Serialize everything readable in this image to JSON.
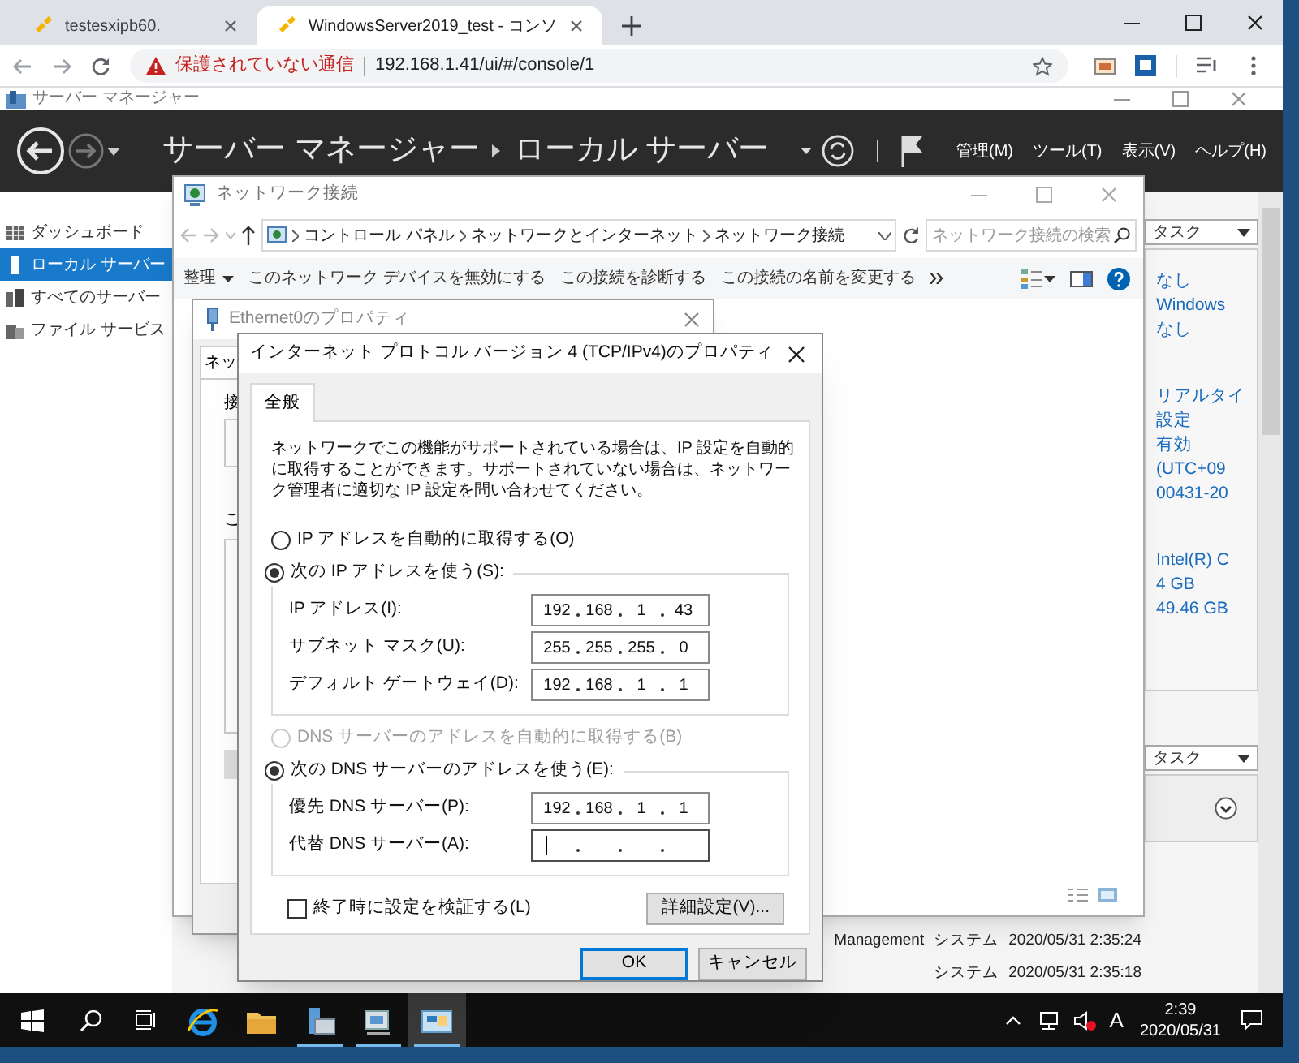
{
  "browser": {
    "tabs": [
      {
        "title": "testesxipb60.",
        "selected": false
      },
      {
        "title": "WindowsServer2019_test - コンソ",
        "selected": true
      }
    ],
    "security_warning": "保護されていない通信",
    "url": "192.168.1.41/ui/#/console/1"
  },
  "server_manager": {
    "title": "サーバー マネージャー",
    "breadcrumb": [
      "サーバー マネージャー",
      "ローカル サーバー"
    ],
    "menu": [
      "管理(M)",
      "ツール(T)",
      "表示(V)",
      "ヘルプ(H)"
    ],
    "sidebar": [
      {
        "label": "ダッシュボード",
        "selected": false
      },
      {
        "label": "ローカル サーバー",
        "selected": true
      },
      {
        "label": "すべてのサーバー",
        "selected": false
      },
      {
        "label": "ファイル サービス",
        "selected": false
      }
    ],
    "properties_tasks": "タスク",
    "property_groups": [
      [
        "なし",
        "Windows",
        "なし"
      ],
      [
        "リアルタイ",
        "設定",
        "有効",
        "(UTC+09",
        "00431-20"
      ],
      [
        "Intel(R) C",
        "4 GB",
        "49.46 GB"
      ]
    ],
    "events_tasks": "タスク",
    "events": [
      {
        "source": "Management",
        "category": "システム",
        "time": "2020/05/31 2:35:24"
      },
      {
        "category": "システム",
        "time": "2020/05/31 2:35:18"
      }
    ]
  },
  "network_window": {
    "title": "ネットワーク接続",
    "path": [
      "コントロール パネル",
      "ネットワークとインターネット",
      "ネットワーク接続"
    ],
    "search_placeholder": "ネットワーク接続の検索",
    "toolbar": [
      "整理",
      "このネットワーク デバイスを無効にする",
      "この接続を診断する",
      "この接続の名前を変更する"
    ]
  },
  "ethernet_window": {
    "title": "Ethernet0のプロパティ",
    "tab": "ネッ",
    "label_1": "接",
    "label_2": "こ"
  },
  "ipv4_dialog": {
    "title": "インターネット プロトコル バージョン 4 (TCP/IPv4)のプロパティ",
    "tabs": [
      {
        "label": "全般",
        "selected": true
      }
    ],
    "description": "ネットワークでこの機能がサポートされている場合は、IP 設定を自動的に取得することができます。サポートされていない場合は、ネットワーク管理者に適切な IP 設定を問い合わせてください。",
    "ip_options": [
      {
        "label": "IP アドレスを自動的に取得する(O)",
        "selected": false
      },
      {
        "label": "次の IP アドレスを使う(S):",
        "selected": true
      }
    ],
    "ip_fields": [
      {
        "label": "IP アドレス(I):",
        "octets": [
          "192",
          "168",
          "1",
          "43"
        ]
      },
      {
        "label": "サブネット マスク(U):",
        "octets": [
          "255",
          "255",
          "255",
          "0"
        ]
      },
      {
        "label": "デフォルト ゲートウェイ(D):",
        "octets": [
          "192",
          "168",
          "1",
          "1"
        ]
      }
    ],
    "dns_options": [
      {
        "label": "DNS サーバーのアドレスを自動的に取得する(B)",
        "selected": false,
        "disabled": true
      },
      {
        "label": "次の DNS サーバーのアドレスを使う(E):",
        "selected": true,
        "disabled": false
      }
    ],
    "dns_fields": [
      {
        "label": "優先 DNS サーバー(P):",
        "octets": [
          "192",
          "168",
          "1",
          "1"
        ],
        "focused": false
      },
      {
        "label": "代替 DNS サーバー(A):",
        "focused": true
      }
    ],
    "validate_checkbox": {
      "label": "終了時に設定を検証する(L)",
      "checked": false
    },
    "advanced_button": "詳細設定(V)...",
    "buttons": [
      {
        "label": "OK",
        "default": true
      },
      {
        "label": "キャンセル",
        "default": false
      }
    ]
  },
  "taskbar": {
    "apps": [
      {
        "running": false,
        "active": false
      },
      {
        "running": false,
        "active": false
      },
      {
        "running": true,
        "active": false
      },
      {
        "running": true,
        "active": false
      },
      {
        "running": true,
        "active": true
      }
    ],
    "ime": "A",
    "time": "2:39",
    "date": "2020/05/31"
  }
}
